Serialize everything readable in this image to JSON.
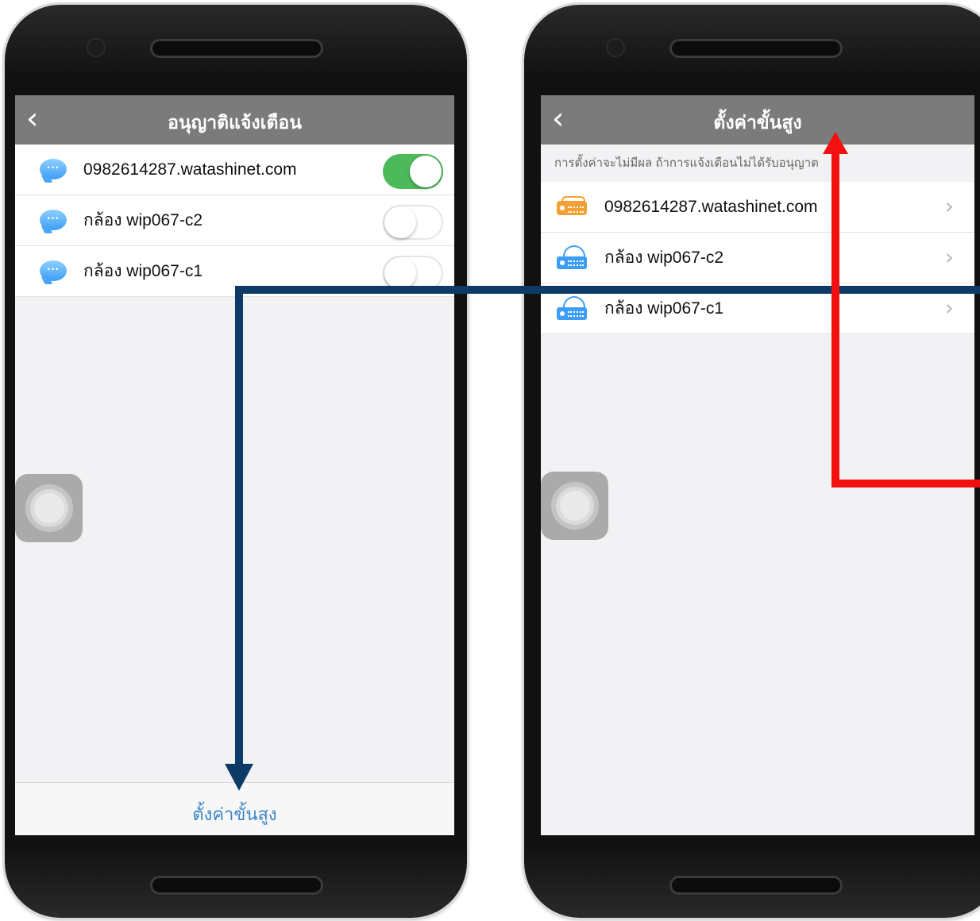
{
  "left_screen": {
    "title": "อนุญาติแจ้งเตือน",
    "back_glyph": "‹",
    "items": [
      {
        "icon": "chat-bubble-icon",
        "label": "0982614287.watashinet.com",
        "enabled": true
      },
      {
        "icon": "chat-bubble-icon",
        "label": "กล้อง wip067-c2",
        "enabled": false
      },
      {
        "icon": "chat-bubble-icon",
        "label": "กล้อง wip067-c1",
        "enabled": false
      }
    ],
    "bottom_link": "ตั้งค่าขั้นสูง"
  },
  "right_screen": {
    "title": "ตั้งค่าขั้นสูง",
    "back_glyph": "‹",
    "hint": "การตั้งค่าจะไม่มีผล ถ้าการแจ้งเตือนไม่ได้รับอนุญาต",
    "devices": [
      {
        "icon": "recorder-icon",
        "label": "0982614287.watashinet.com",
        "chevron": "›"
      },
      {
        "icon": "cloud-camera-icon",
        "label": "กล้อง wip067-c2",
        "chevron": "›"
      },
      {
        "icon": "cloud-camera-icon",
        "label": "กล้อง wip067-c1",
        "chevron": "›"
      }
    ]
  },
  "annotations": {
    "blue_arrow_color": "#0d3a66",
    "red_arrow_color": "#f21010"
  }
}
